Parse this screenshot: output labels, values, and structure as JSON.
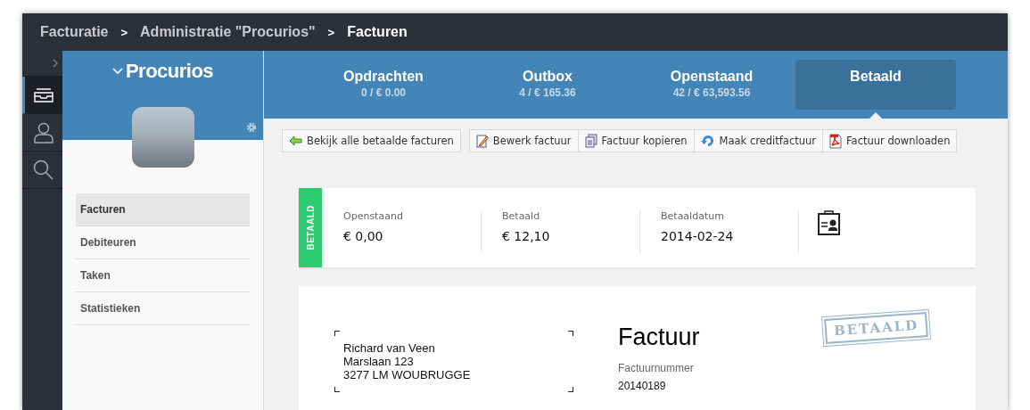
{
  "breadcrumbs": [
    {
      "label": "Facturatie",
      "current": false
    },
    {
      "label": "Administratie \"Procurios\"",
      "current": false
    },
    {
      "label": "Facturen",
      "current": true
    }
  ],
  "breadcrumb_separator": ">",
  "rail": [
    {
      "kind": "inbox",
      "selected": true
    },
    {
      "kind": "user",
      "selected": false
    },
    {
      "kind": "search",
      "selected": false
    }
  ],
  "account": {
    "name": "Procurios"
  },
  "menu": [
    {
      "label": "Facturen",
      "selected": true
    },
    {
      "label": "Debiteuren",
      "selected": false
    },
    {
      "label": "Taken",
      "selected": false
    },
    {
      "label": "Statistieken",
      "selected": false
    }
  ],
  "tabs": [
    {
      "label": "Opdrachten",
      "count": "0 / € 0.00",
      "selected": false
    },
    {
      "label": "Outbox",
      "count": "4 / € 165.36",
      "selected": false
    },
    {
      "label": "Openstaand",
      "count": "42 / € 63,593.56",
      "selected": false
    },
    {
      "label": "Betaald",
      "selected": true
    }
  ],
  "toolbar": [
    [
      {
        "label": "Bekijk alle betaalde facturen",
        "kind": "back"
      }
    ],
    [
      {
        "label": "Bewerk factuur",
        "kind": "edit"
      },
      {
        "label": "Factuur kopieren",
        "kind": "copy"
      },
      {
        "label": "Maak creditfactuur",
        "kind": "undo"
      },
      {
        "label": "Factuur downloaden",
        "kind": "pdf"
      }
    ]
  ],
  "status": {
    "badge": "BETAALD",
    "fields": [
      {
        "label": "Openstaand",
        "value": "€ 0,00"
      },
      {
        "label": "Betaald",
        "value": "€ 12,10"
      },
      {
        "label": "Betaaldatum",
        "value": "2014-02-24"
      }
    ]
  },
  "invoice": {
    "address": [
      "Richard van Veen",
      "Marslaan 123",
      "3277 LM WOUBRUGGE"
    ],
    "title": "Factuur",
    "number_label": "Factuurnummer",
    "number": "20140189",
    "stamp": "BETAALD"
  }
}
